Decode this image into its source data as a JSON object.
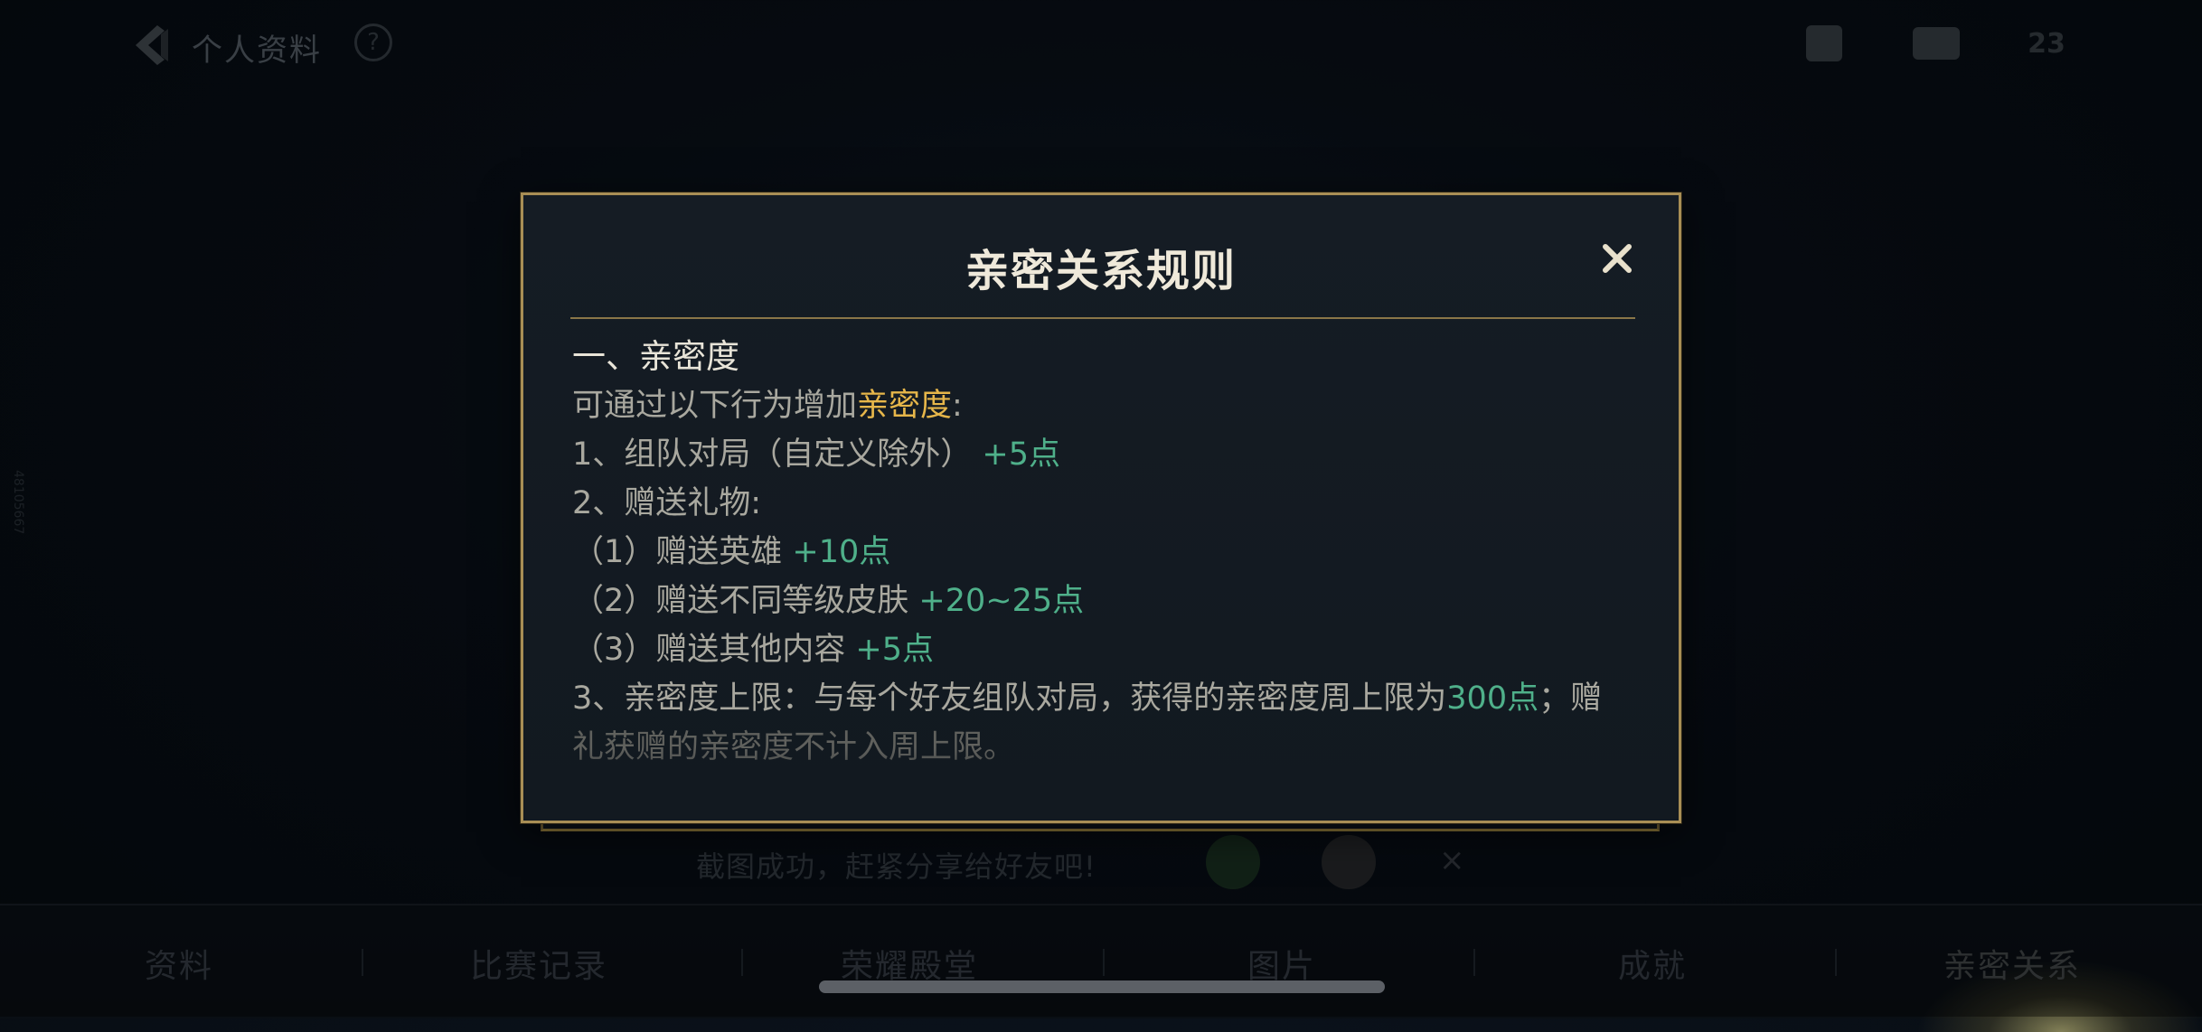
{
  "background": {
    "header": {
      "title": "个人资料",
      "help_glyph": "?",
      "right_icon_3": "23"
    },
    "side_id": "48105667",
    "share": {
      "text": "截图成功，赶紧分享给好友吧!"
    },
    "tabs": [
      {
        "label": "资料"
      },
      {
        "label": "比赛记录"
      },
      {
        "label": "荣耀殿堂"
      },
      {
        "label": "图片"
      },
      {
        "label": "成就"
      },
      {
        "label": "亲密关系"
      }
    ]
  },
  "modal": {
    "title": "亲密关系规则",
    "lines": {
      "section1": "一、亲密度",
      "intro_prefix": "可通过以下行为增加",
      "intro_highlight": "亲密度",
      "intro_suffix": ":",
      "item1_text": "1、组队对局（自定义除外）",
      "item1_points": "+5点",
      "item2_text": "2、赠送礼物:",
      "item2a_text": "（1）赠送英雄",
      "item2a_points": "+10点",
      "item2b_text": "（2）赠送不同等级皮肤",
      "item2b_points": "+20~25点",
      "item2c_text": "（3）赠送其他内容",
      "item2c_points": "+5点",
      "item3_prefix": "3、亲密度上限：与每个好友组队对局，获得的亲密度周上限为",
      "item3_points": "300点",
      "item3_suffix": "；赠",
      "item3_cont": "礼获赠的亲密度不计入周上限。"
    }
  },
  "colors": {
    "gold_border": "#a88e55",
    "highlight_gold": "#e6b64a",
    "highlight_green": "#4fb08a",
    "body_text": "#a9a89f",
    "title_text": "#efe9da"
  },
  "icons": {
    "back": "back-arrow-icon",
    "help": "help-icon",
    "close": "close-icon",
    "wechat": "wechat-icon",
    "moments": "moments-icon"
  }
}
